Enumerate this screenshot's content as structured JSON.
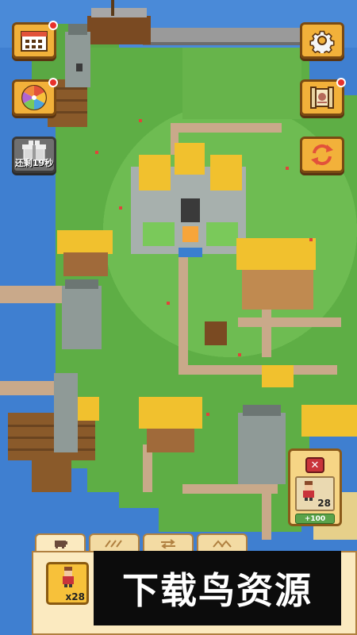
{
  "hud": {
    "left_buttons": [
      {
        "name": "calendar-button",
        "icon": "calendar-icon",
        "badge": true
      },
      {
        "name": "lucky-wheel-button",
        "icon": "wheel-icon",
        "badge": true
      },
      {
        "name": "gift-button",
        "icon": "gift-icon",
        "badge": false,
        "timer": "还剩19秒"
      }
    ],
    "right_buttons": [
      {
        "name": "settings-button",
        "icon": "gear-icon",
        "badge": false
      },
      {
        "name": "quest-scroll-button",
        "icon": "scroll-icon",
        "badge": true
      },
      {
        "name": "refresh-button",
        "icon": "refresh-arrows-icon",
        "badge": false
      }
    ]
  },
  "recruit_panel": {
    "close_label": "✕",
    "unit_count": "28",
    "cost": "+100"
  },
  "bottom_tray": {
    "tabs": [
      {
        "name": "tab-pig",
        "icon": "pig-icon",
        "label": "🐖"
      },
      {
        "name": "tab-arrows",
        "icon": "arrows-icon",
        "label": "⟋⟋⟋"
      },
      {
        "name": "tab-swap",
        "icon": "swap-icon",
        "label": "⇄"
      },
      {
        "name": "tab-peak",
        "icon": "peak-icon",
        "label": "︿︿"
      }
    ],
    "unit_card_count": "x28"
  },
  "watermark": {
    "text": "下载鸟资源"
  },
  "colors": {
    "ocean": "#3f7fd0",
    "grass": "#62b24a",
    "path": "#c9a98a",
    "roof": "#f1c12e",
    "stone": "#8f9a97",
    "button_orange": "#f2b13a"
  }
}
